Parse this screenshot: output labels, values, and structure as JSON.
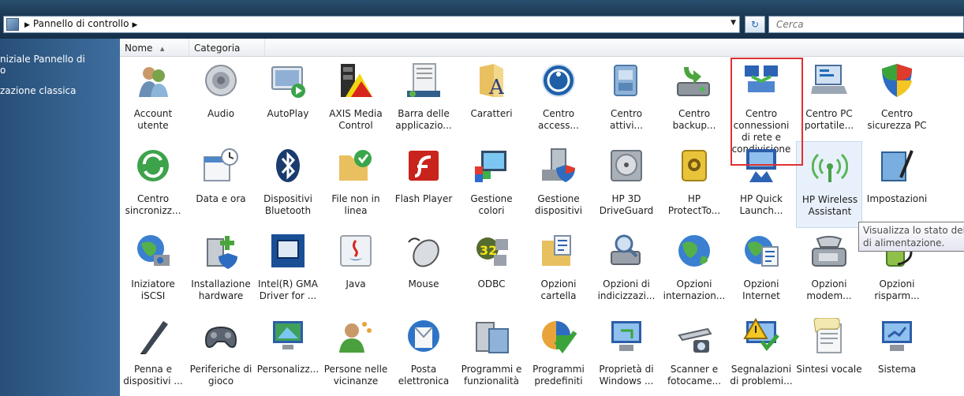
{
  "address": {
    "crumbs": [
      "Pannello di controllo"
    ],
    "search_placeholder": "Cerca"
  },
  "sidebar": {
    "links": [
      "niziale Pannello di",
      "o",
      "zazione classica"
    ]
  },
  "columns": {
    "name": "Nome",
    "category": "Categoria"
  },
  "tooltip": {
    "line1": "Visualizza lo stato dell",
    "line2": "di alimentazione."
  },
  "rows": [
    [
      {
        "label": "Account utente",
        "icon": "account-utente-icon"
      },
      {
        "label": "Audio",
        "icon": "audio-icon"
      },
      {
        "label": "AutoPlay",
        "icon": "autoplay-icon"
      },
      {
        "label": "AXIS Media Control",
        "icon": "axis-media-control-icon"
      },
      {
        "label": "Barra delle applicazio...",
        "icon": "barra-delle-applicazioni-icon"
      },
      {
        "label": "Caratteri",
        "icon": "caratteri-icon"
      },
      {
        "label": "Centro access...",
        "icon": "centro-accessibilita-icon"
      },
      {
        "label": "Centro attivi...",
        "icon": "centro-attivita-icon"
      },
      {
        "label": "Centro backup...",
        "icon": "centro-backup-icon"
      },
      {
        "label": "Centro connessioni di rete e condivisione",
        "icon": "centro-connessioni-rete-icon"
      },
      {
        "label": "Centro PC portatile...",
        "icon": "centro-pc-portatile-icon"
      },
      {
        "label": "Centro sicurezza PC",
        "icon": "centro-sicurezza-icon"
      }
    ],
    [
      {
        "label": "Centro sincronizz...",
        "icon": "centro-sincronizzazione-icon"
      },
      {
        "label": "Data e ora",
        "icon": "data-e-ora-icon"
      },
      {
        "label": "Dispositivi Bluetooth",
        "icon": "bluetooth-icon"
      },
      {
        "label": "File non in linea",
        "icon": "file-non-in-linea-icon"
      },
      {
        "label": "Flash Player",
        "icon": "flash-player-icon"
      },
      {
        "label": "Gestione colori",
        "icon": "gestione-colori-icon"
      },
      {
        "label": "Gestione dispositivi",
        "icon": "gestione-dispositivi-icon"
      },
      {
        "label": "HP 3D DriveGuard",
        "icon": "hp-driveguard-icon"
      },
      {
        "label": "HP ProtectTo...",
        "icon": "hp-protecttools-icon"
      },
      {
        "label": "HP Quick Launch...",
        "icon": "hp-quick-launch-icon"
      },
      {
        "label": "HP Wireless Assistant",
        "icon": "hp-wireless-assistant-icon"
      },
      {
        "label": "Impostazioni",
        "icon": "impostazioni-icon"
      }
    ],
    [
      {
        "label": "Iniziatore iSCSI",
        "icon": "iniziatore-iscsi-icon"
      },
      {
        "label": "Installazione hardware",
        "icon": "installazione-hardware-icon"
      },
      {
        "label": "Intel(R) GMA Driver for ...",
        "icon": "intel-gma-driver-icon"
      },
      {
        "label": "Java",
        "icon": "java-icon"
      },
      {
        "label": "Mouse",
        "icon": "mouse-icon"
      },
      {
        "label": "ODBC",
        "icon": "odbc-icon"
      },
      {
        "label": "Opzioni cartella",
        "icon": "opzioni-cartella-icon"
      },
      {
        "label": "Opzioni di indicizzazi...",
        "icon": "opzioni-indicizzazione-icon"
      },
      {
        "label": "Opzioni internazion...",
        "icon": "opzioni-internazionali-icon"
      },
      {
        "label": "Opzioni Internet",
        "icon": "opzioni-internet-icon"
      },
      {
        "label": "Opzioni modem...",
        "icon": "opzioni-modem-icon"
      },
      {
        "label": "Opzioni risparm...",
        "icon": "opzioni-risparmio-energia-icon"
      }
    ],
    [
      {
        "label": "Penna e dispositivi ...",
        "icon": "penna-e-dispositivi-icon"
      },
      {
        "label": "Periferiche di gioco",
        "icon": "periferiche-di-gioco-icon"
      },
      {
        "label": "Personalizz...",
        "icon": "personalizzazione-icon"
      },
      {
        "label": "Persone nelle vicinanze",
        "icon": "persone-nelle-vicinanze-icon"
      },
      {
        "label": "Posta elettronica",
        "icon": "posta-elettronica-icon"
      },
      {
        "label": "Programmi e funzionalità",
        "icon": "programmi-e-funzionalita-icon"
      },
      {
        "label": "Programmi predefiniti",
        "icon": "programmi-predefiniti-icon"
      },
      {
        "label": "Proprietà di Windows ...",
        "icon": "proprieta-windows-icon"
      },
      {
        "label": "Scanner e fotocame...",
        "icon": "scanner-e-fotocamere-icon"
      },
      {
        "label": "Segnalazioni di problemi...",
        "icon": "segnalazioni-problemi-icon"
      },
      {
        "label": "Sintesi vocale",
        "icon": "sintesi-vocale-icon"
      },
      {
        "label": "Sistema",
        "icon": "sistema-icon"
      }
    ]
  ]
}
